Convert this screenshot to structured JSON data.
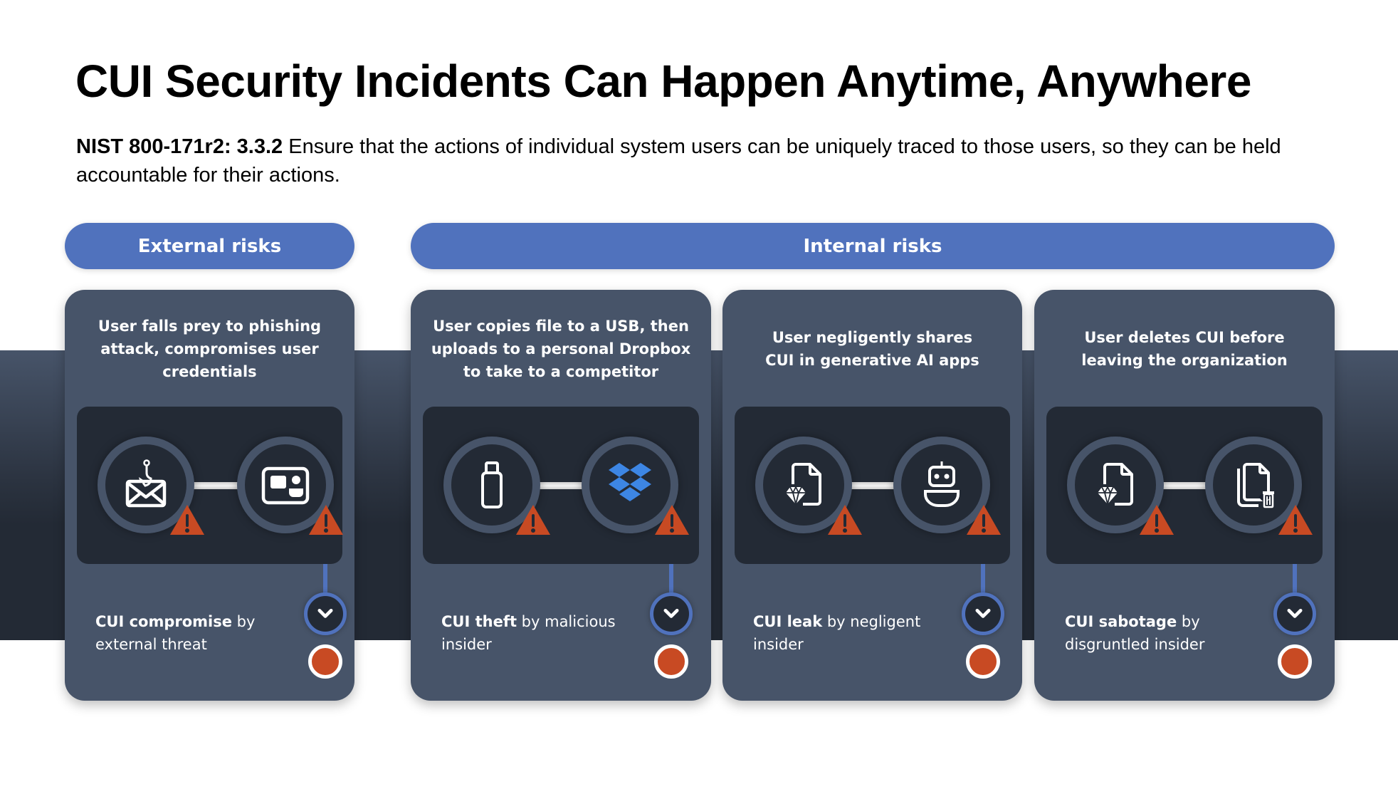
{
  "title": "CUI Security Incidents Can Happen Anytime, Anywhere",
  "subtitle": {
    "reference": "NIST 800-171r2: 3.3.2",
    "text": " Ensure that the actions of individual system users can be uniquely traced to those users, so they can be held accountable for their actions."
  },
  "groups": {
    "external": "External risks",
    "internal": "Internal risks"
  },
  "colors": {
    "accent": "#5072bd",
    "card": "#475469",
    "panel": "#232a35",
    "warning": "#c84a23",
    "dropbox": "#3d86e4"
  },
  "cards": [
    {
      "description": "User falls prey to phishing attack, compromises user credentials",
      "icons": [
        "phishing-email-icon",
        "credentials-card-icon"
      ],
      "outcome_bold": "CUI compromise",
      "outcome_rest": " by external threat"
    },
    {
      "description": "User copies file to a USB, then uploads to a personal Dropbox to take to a competitor",
      "icons": [
        "usb-drive-icon",
        "dropbox-icon"
      ],
      "outcome_bold": "CUI theft",
      "outcome_rest": " by malicious insider"
    },
    {
      "description": "User negligently shares CUI in generative AI apps",
      "icons": [
        "sensitive-document-icon",
        "ai-bot-icon"
      ],
      "outcome_bold": "CUI leak",
      "outcome_rest": " by negligent insider"
    },
    {
      "description": "User deletes CUI before leaving the organization",
      "icons": [
        "sensitive-document-icon",
        "delete-files-icon"
      ],
      "outcome_bold": "CUI sabotage",
      "outcome_rest": " by disgruntled insider"
    }
  ]
}
